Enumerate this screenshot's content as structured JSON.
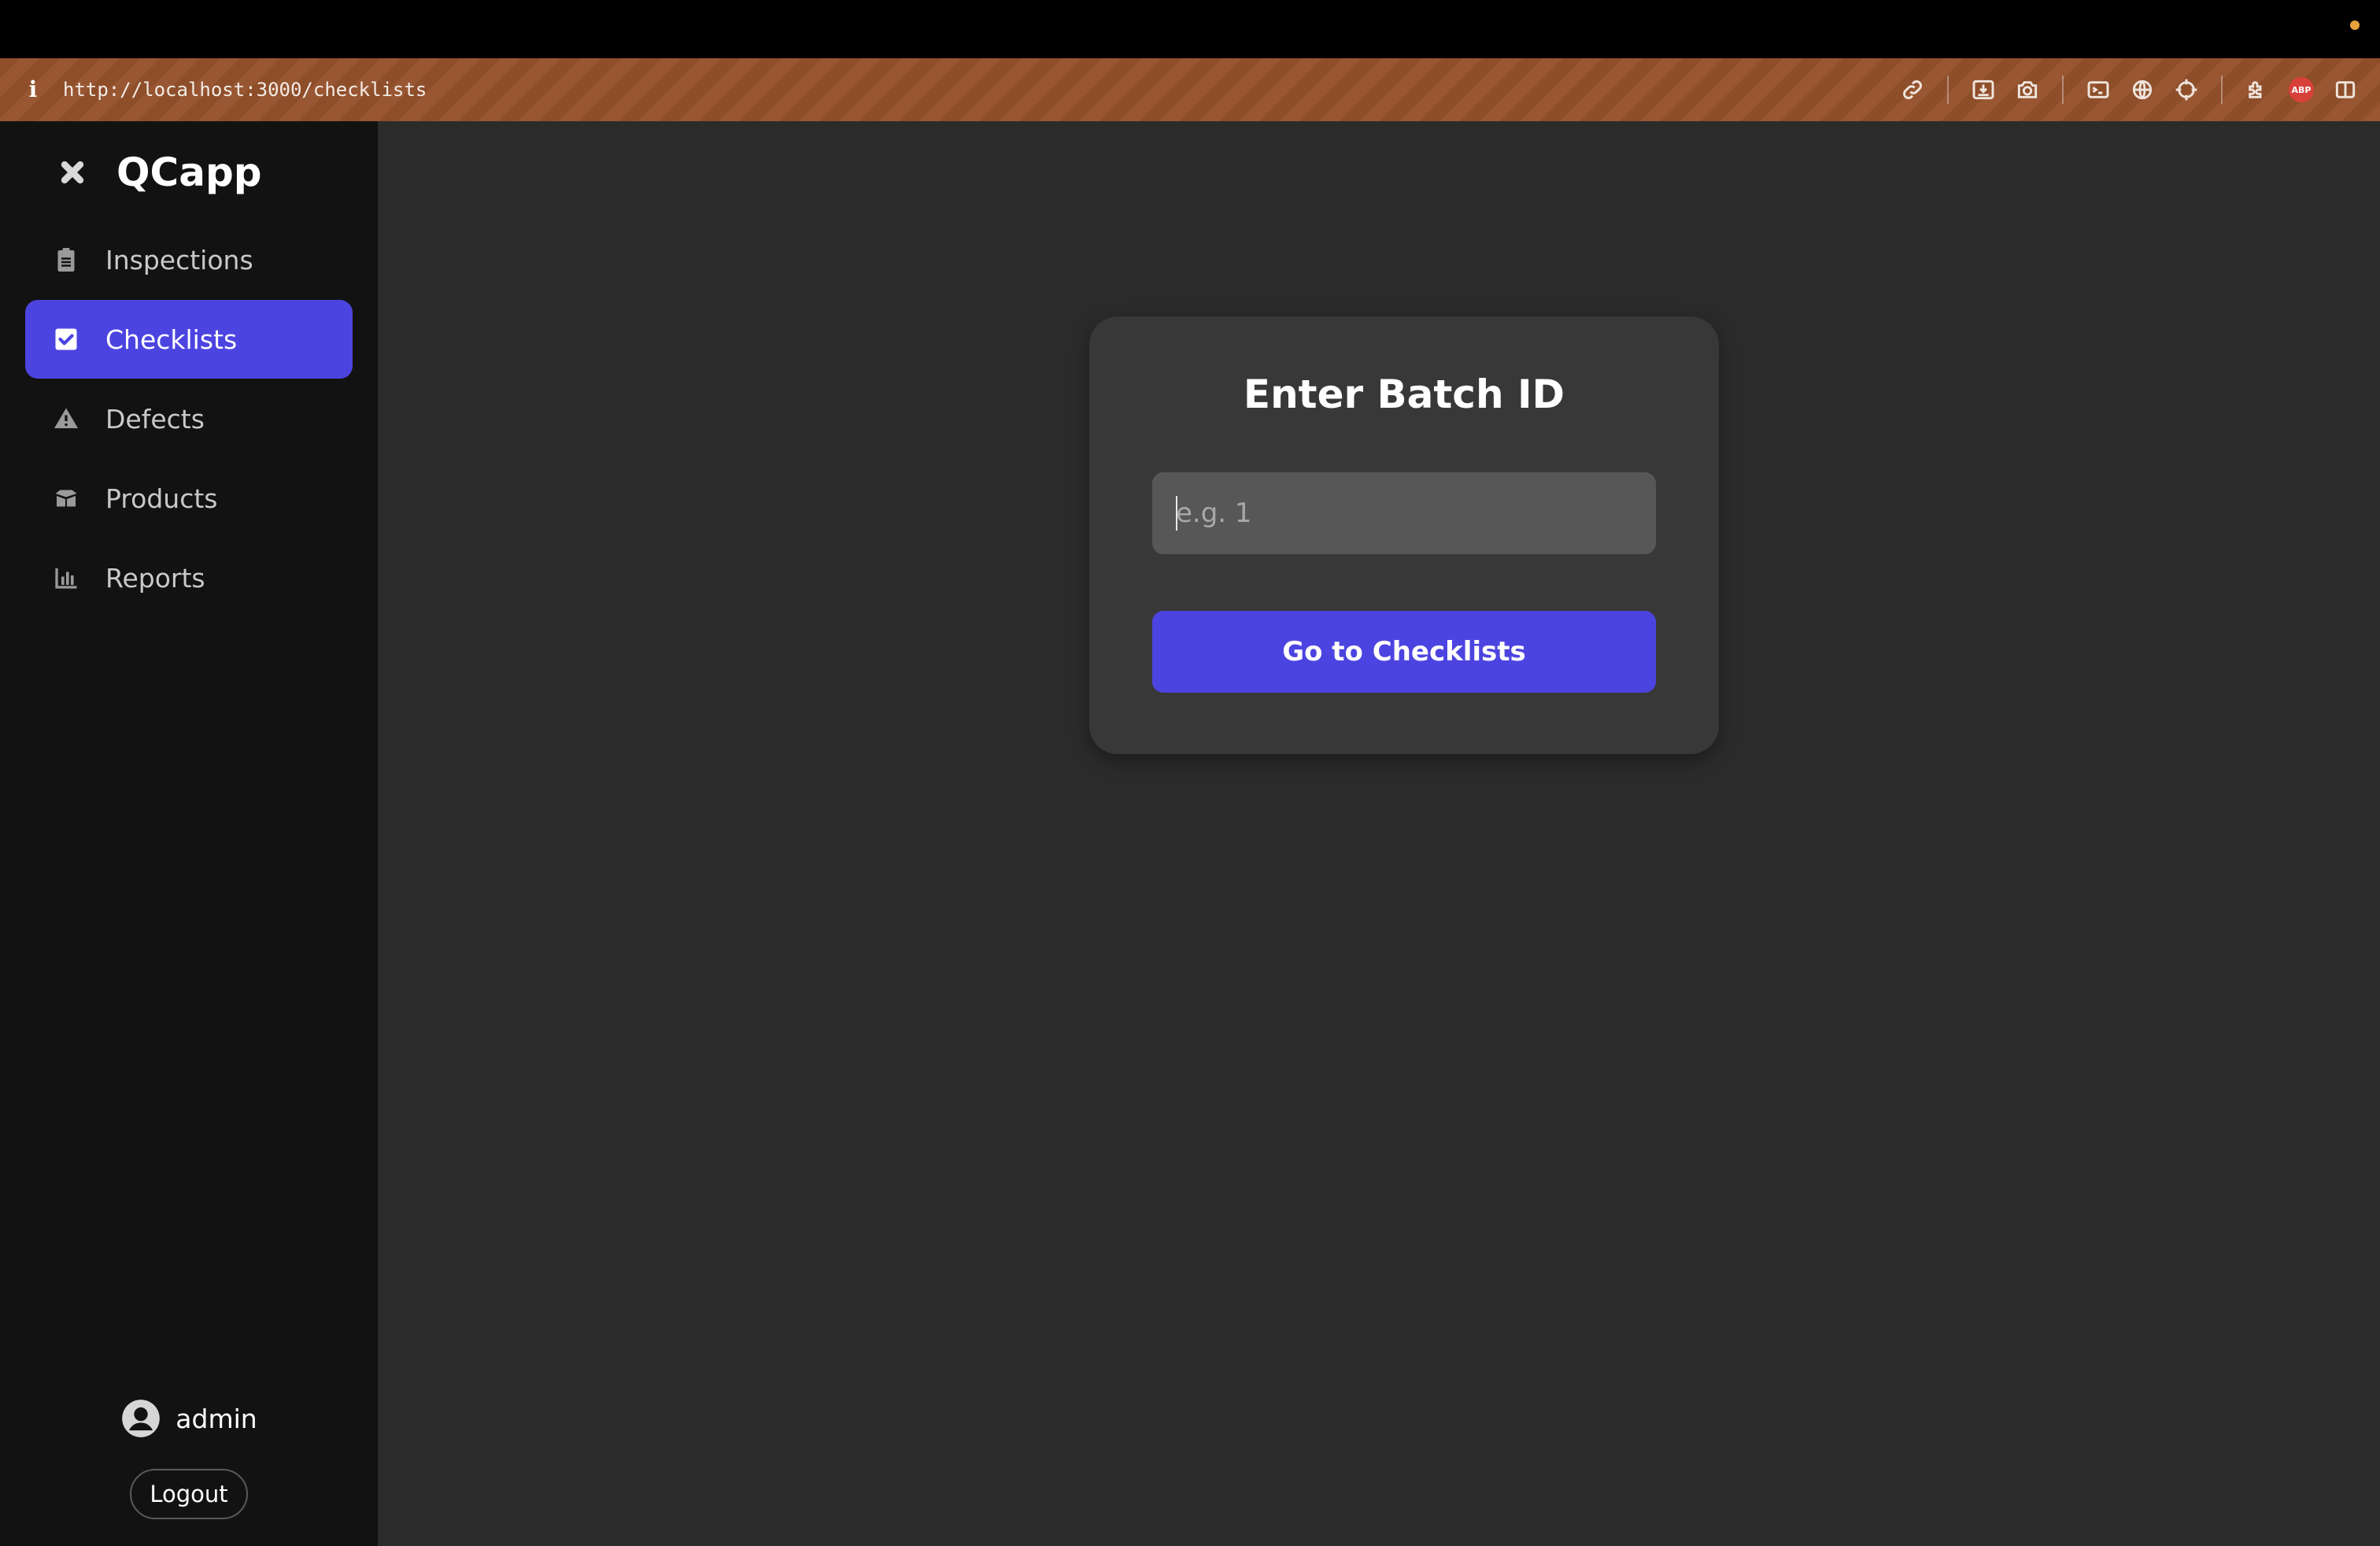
{
  "browser": {
    "url": "http://localhost:3000/checklists",
    "info_glyph": "i",
    "abp_label": "ABP",
    "toolbar_icons": [
      "link-icon",
      "save-page-icon",
      "camera-icon",
      "terminal-icon",
      "globe-icon",
      "crosshair-icon",
      "extensions-icon",
      "adblock-icon",
      "split-view-icon"
    ]
  },
  "sidebar": {
    "brand": "QCapp",
    "items": [
      {
        "label": "Inspections",
        "icon": "clipboard-icon",
        "active": false
      },
      {
        "label": "Checklists",
        "icon": "checkbox-icon",
        "active": true
      },
      {
        "label": "Defects",
        "icon": "warning-icon",
        "active": false
      },
      {
        "label": "Products",
        "icon": "box-icon",
        "active": false
      },
      {
        "label": "Reports",
        "icon": "bar-chart-icon",
        "active": false
      }
    ],
    "user": {
      "name": "admin"
    },
    "logout_label": "Logout"
  },
  "card": {
    "title": "Enter Batch ID",
    "input_placeholder": "e.g. 1",
    "input_value": "",
    "button_label": "Go to Checklists"
  },
  "colors": {
    "accent": "#4c44e0",
    "sidebar_bg": "#121212",
    "main_bg": "#2b2b2b",
    "card_bg": "#383838",
    "urlbar_bg": "#8e4e2a"
  }
}
